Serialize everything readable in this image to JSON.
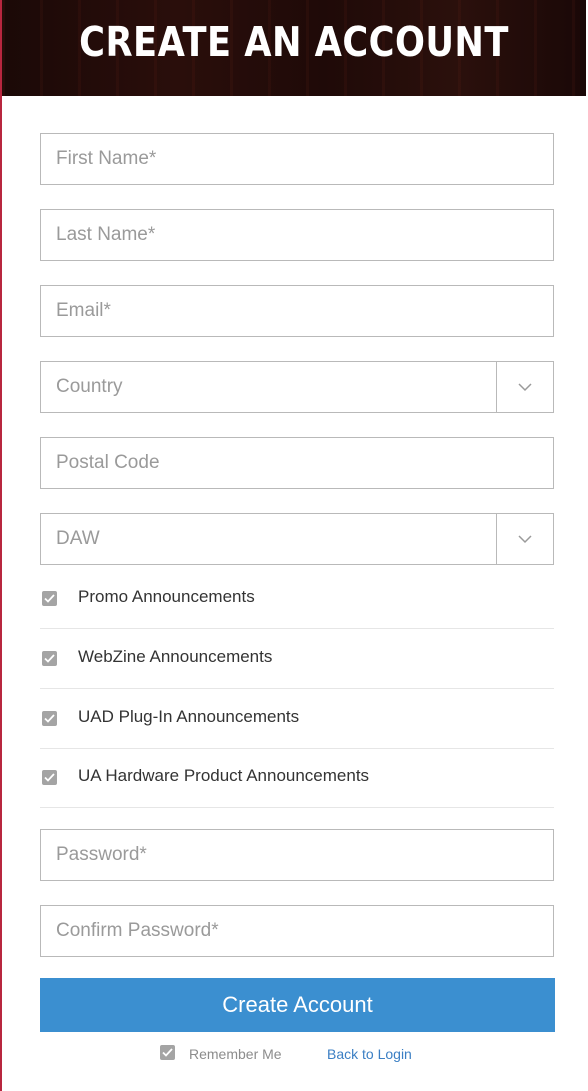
{
  "header": {
    "title": "CREATE AN ACCOUNT"
  },
  "form": {
    "first_name": {
      "placeholder": "First Name*",
      "value": ""
    },
    "last_name": {
      "placeholder": "Last Name*",
      "value": ""
    },
    "email": {
      "placeholder": "Email*",
      "value": ""
    },
    "country": {
      "selected": "Country"
    },
    "postal_code": {
      "placeholder": "Postal Code",
      "value": ""
    },
    "daw": {
      "selected": "DAW"
    },
    "password": {
      "placeholder": "Password*",
      "value": ""
    },
    "confirm_password": {
      "placeholder": "Confirm Password*",
      "value": ""
    }
  },
  "announcements": [
    {
      "label": "Promo Announcements",
      "checked": true
    },
    {
      "label": "WebZine Announcements",
      "checked": true
    },
    {
      "label": "UAD Plug-In Announcements",
      "checked": true
    },
    {
      "label": "UA Hardware Product Announcements",
      "checked": true
    }
  ],
  "submit_label": "Create Account",
  "remember": {
    "label": "Remember Me",
    "checked": true
  },
  "back_link": "Back to Login",
  "colors": {
    "accent": "#3b8fd0",
    "link": "#3b7fc4",
    "border": "#b9b9b9",
    "checkbox": "#a4a4a4"
  },
  "icons": {
    "select_arrow": "chevron-down-icon",
    "checkbox": "checkmark-icon"
  }
}
